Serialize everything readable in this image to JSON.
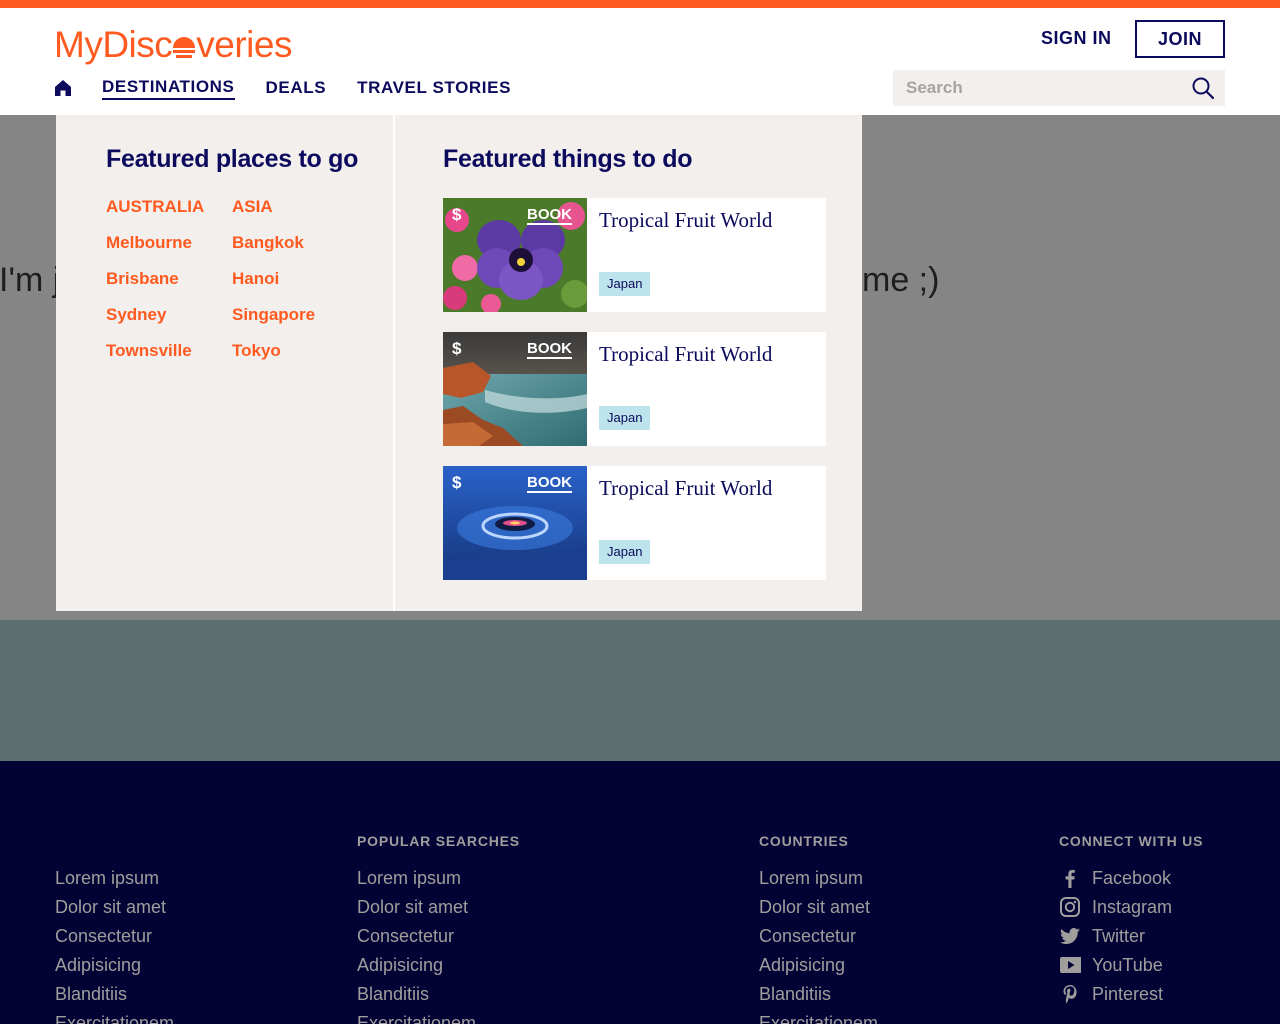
{
  "header": {
    "logo_before": "MyDisc",
    "logo_after": "veries",
    "sign_in": "SIGN IN",
    "join": "JOIN",
    "nav": [
      {
        "label": "DESTINATIONS",
        "active": true
      },
      {
        "label": "DEALS",
        "active": false
      },
      {
        "label": "TRAVEL STORIES",
        "active": false
      }
    ],
    "search_placeholder": "Search"
  },
  "hero": {
    "text_left": "I'm j",
    "text_right": "me ;)"
  },
  "megamenu": {
    "places_heading": "Featured places to go",
    "things_heading": "Featured things to do",
    "places_columns": [
      [
        "AUSTRALIA",
        "Melbourne",
        "Brisbane",
        "Sydney",
        "Townsville"
      ],
      [
        "ASIA",
        "Bangkok",
        "Hanoi",
        "Singapore",
        "Tokyo"
      ]
    ],
    "cards": [
      {
        "price_symbol": "$",
        "book": "BOOK",
        "title": "Tropical Fruit World",
        "tag": "Japan",
        "image": "pansy-flower"
      },
      {
        "price_symbol": "$",
        "book": "BOOK",
        "title": "Tropical Fruit World",
        "tag": "Japan",
        "image": "rocky-coast"
      },
      {
        "price_symbol": "$",
        "book": "BOOK",
        "title": "Tropical Fruit World",
        "tag": "Japan",
        "image": "water-drop"
      }
    ]
  },
  "footer": {
    "columns": [
      {
        "title": "",
        "items": [
          "Lorem ipsum",
          "Dolor sit amet",
          "Consectetur",
          "Adipisicing",
          "Blanditiis",
          "Exercitationem"
        ]
      },
      {
        "title": "POPULAR SEARCHES",
        "items": [
          "Lorem ipsum",
          "Dolor sit amet",
          "Consectetur",
          "Adipisicing",
          "Blanditiis",
          "Exercitationem"
        ]
      },
      {
        "title": "COUNTRIES",
        "items": [
          "Lorem ipsum",
          "Dolor sit amet",
          "Consectetur",
          "Adipisicing",
          "Blanditiis",
          "Exercitationem"
        ]
      }
    ],
    "connect": {
      "title": "CONNECT WITH US",
      "items": [
        {
          "label": "Facebook",
          "icon": "facebook-icon"
        },
        {
          "label": "Instagram",
          "icon": "instagram-icon"
        },
        {
          "label": "Twitter",
          "icon": "twitter-icon"
        },
        {
          "label": "YouTube",
          "icon": "youtube-icon"
        },
        {
          "label": "Pinterest",
          "icon": "pinterest-icon"
        }
      ]
    }
  },
  "colors": {
    "accent": "#ff5a1f",
    "navy": "#0b0a5c",
    "footer_bg": "#030234",
    "menu_bg": "#f3efed",
    "tag_bg": "#bde3ec"
  }
}
